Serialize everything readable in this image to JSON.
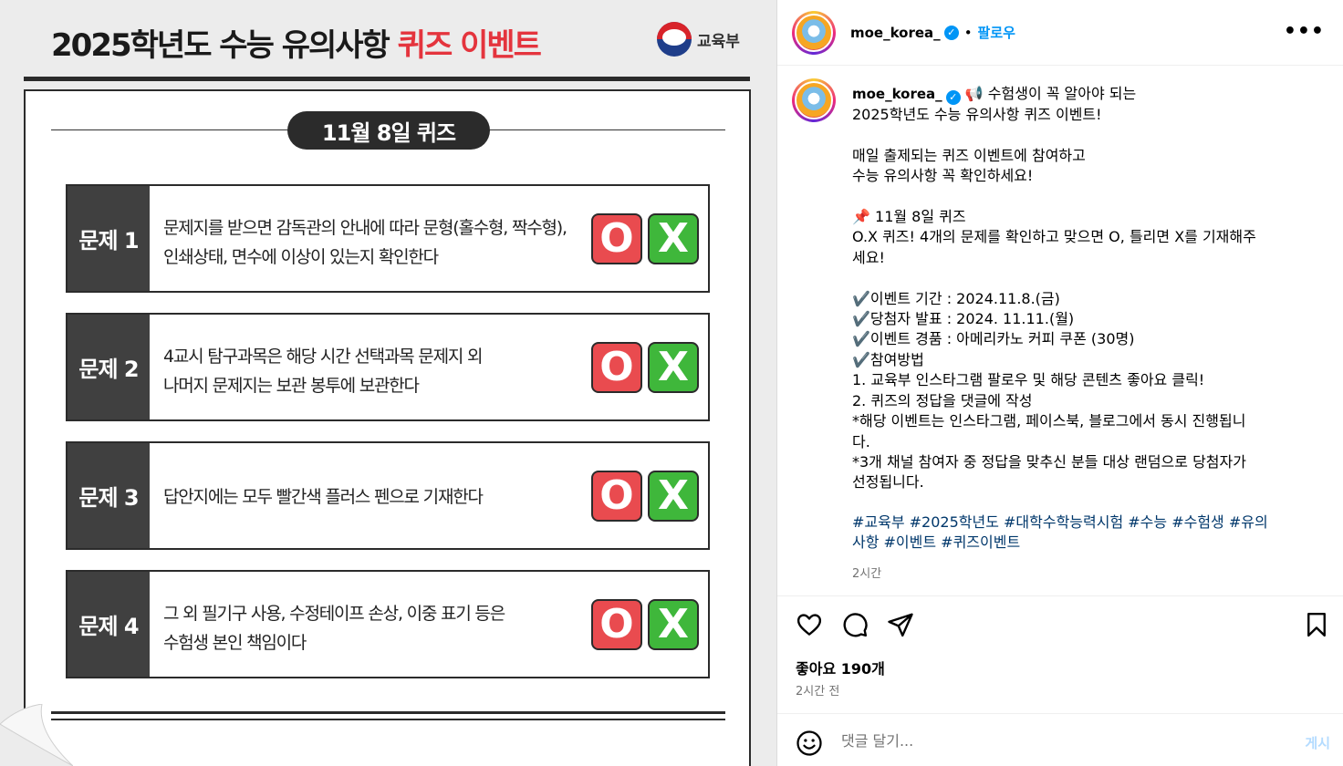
{
  "post_image": {
    "title_main": "2025학년도 수능 유의사항 ",
    "title_accent": "퀴즈 이벤트",
    "ministry": "교육부",
    "date_pill": "11월 8일 퀴즈",
    "o_label": "O",
    "x_label": "X",
    "questions": [
      {
        "label": "문제 1",
        "line1": "문제지를 받으면 감독관의 안내에 따라 문형(홀수형, 짝수형),",
        "line2": "인쇄상태, 면수에 이상이 있는지 확인한다"
      },
      {
        "label": "문제 2",
        "line1": "4교시 탐구과목은 해당 시간 선택과목 문제지 외",
        "line2": "나머지 문제지는 보관 봉투에 보관한다"
      },
      {
        "label": "문제 3",
        "line1": "답안지에는 모두 빨간색 플러스 펜으로 기재한다",
        "line2": ""
      },
      {
        "label": "문제 4",
        "line1": "그 외 필기구 사용, 수정테이프 손상, 이중 표기 등은",
        "line2": "수험생 본인 책임이다"
      }
    ]
  },
  "header": {
    "username": "moe_korea_",
    "dot": "•",
    "follow": "팔로우",
    "more": "•••"
  },
  "caption": {
    "username": "moe_korea_",
    "lines": [
      "📢 수험생이 꼭 알아야 되는",
      "2025학년도 수능 유의사항 퀴즈 이벤트!",
      "",
      "매일 출제되는 퀴즈 이벤트에 참여하고",
      "수능 유의사항 꼭 확인하세요!",
      "",
      "📌 11월 8일 퀴즈",
      "O.X 퀴즈! 4개의 문제를 확인하고 맞으면 O, 틀리면 X를 기재해주",
      "세요!",
      "",
      "✔️이벤트 기간 : 2024.11.8.(금)",
      "✔️당첨자 발표 : 2024. 11.11.(월)",
      "✔️이벤트 경품 : 아메리카노 커피 쿠폰 (30명)",
      "✔️참여방법",
      "1. 교육부 인스타그램 팔로우 및 해당 콘텐츠 좋아요 클릭!",
      "2. 퀴즈의 정답을 댓글에 작성",
      "*해당 이벤트는 인스타그램, 페이스북, 블로그에서 동시 진행됩니",
      "다.",
      "*3개 채널 참여자 중 정답을 맞추신 분들 대상 랜덤으로 당첨자가",
      "선정됩니다."
    ],
    "hashtags_line1": "#교육부 #2025학년도 #대학수학능력시험 #수능 #수험생 #유의",
    "hashtags_line2": "사항 #이벤트 #퀴즈이벤트",
    "time": "2시간"
  },
  "footer": {
    "likes": "좋아요 190개",
    "time": "2시간 전",
    "comment_placeholder": "댓글 달기...",
    "post_button": "게시"
  }
}
